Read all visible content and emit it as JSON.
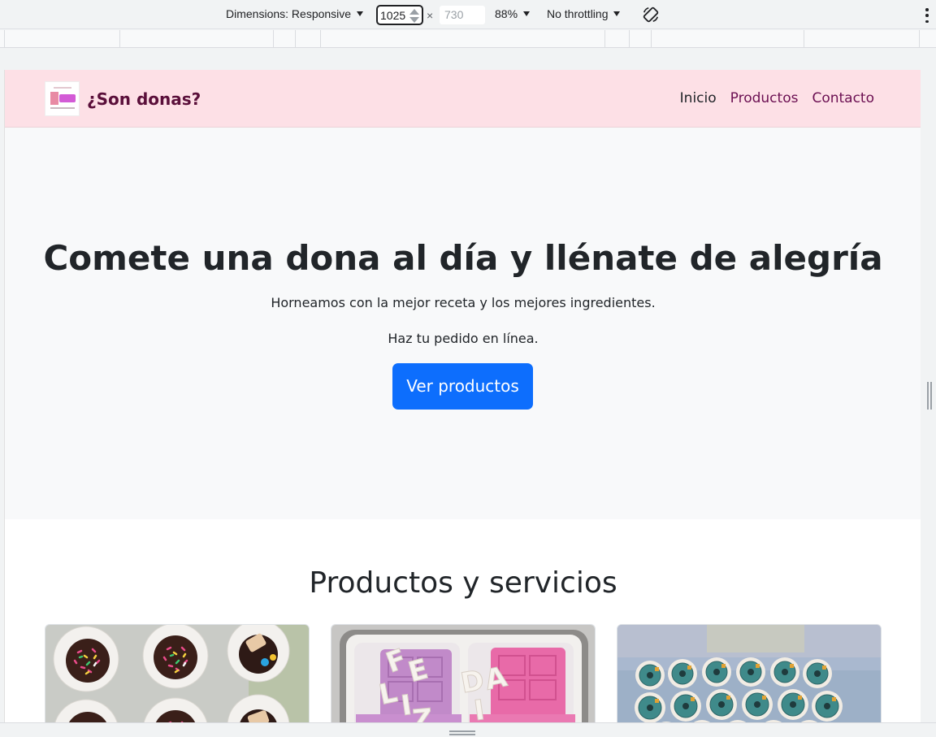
{
  "devtools": {
    "dimensions_label": "Dimensions: Responsive",
    "width_value": "1025",
    "times": "×",
    "height_placeholder": "730",
    "zoom": "88%",
    "throttling": "No throttling"
  },
  "site": {
    "brand": "¿Son donas?",
    "nav": [
      {
        "label": "Inicio",
        "active": true
      },
      {
        "label": "Productos",
        "active": false
      },
      {
        "label": "Contacto",
        "active": false
      }
    ]
  },
  "hero": {
    "title": "Comete una dona al día y llénate de alegría",
    "lead1": "Horneamos con la mejor receta y los mejores ingredientes.",
    "lead2": "Haz tu pedido en línea.",
    "cta": "Ver productos"
  },
  "products": {
    "heading": "Productos y servicios"
  },
  "colors": {
    "navbar_bg": "#fde0e6",
    "brand": "#5a0f3a",
    "primary": "#0d6efd",
    "hero_bg": "#f8f9fa"
  }
}
